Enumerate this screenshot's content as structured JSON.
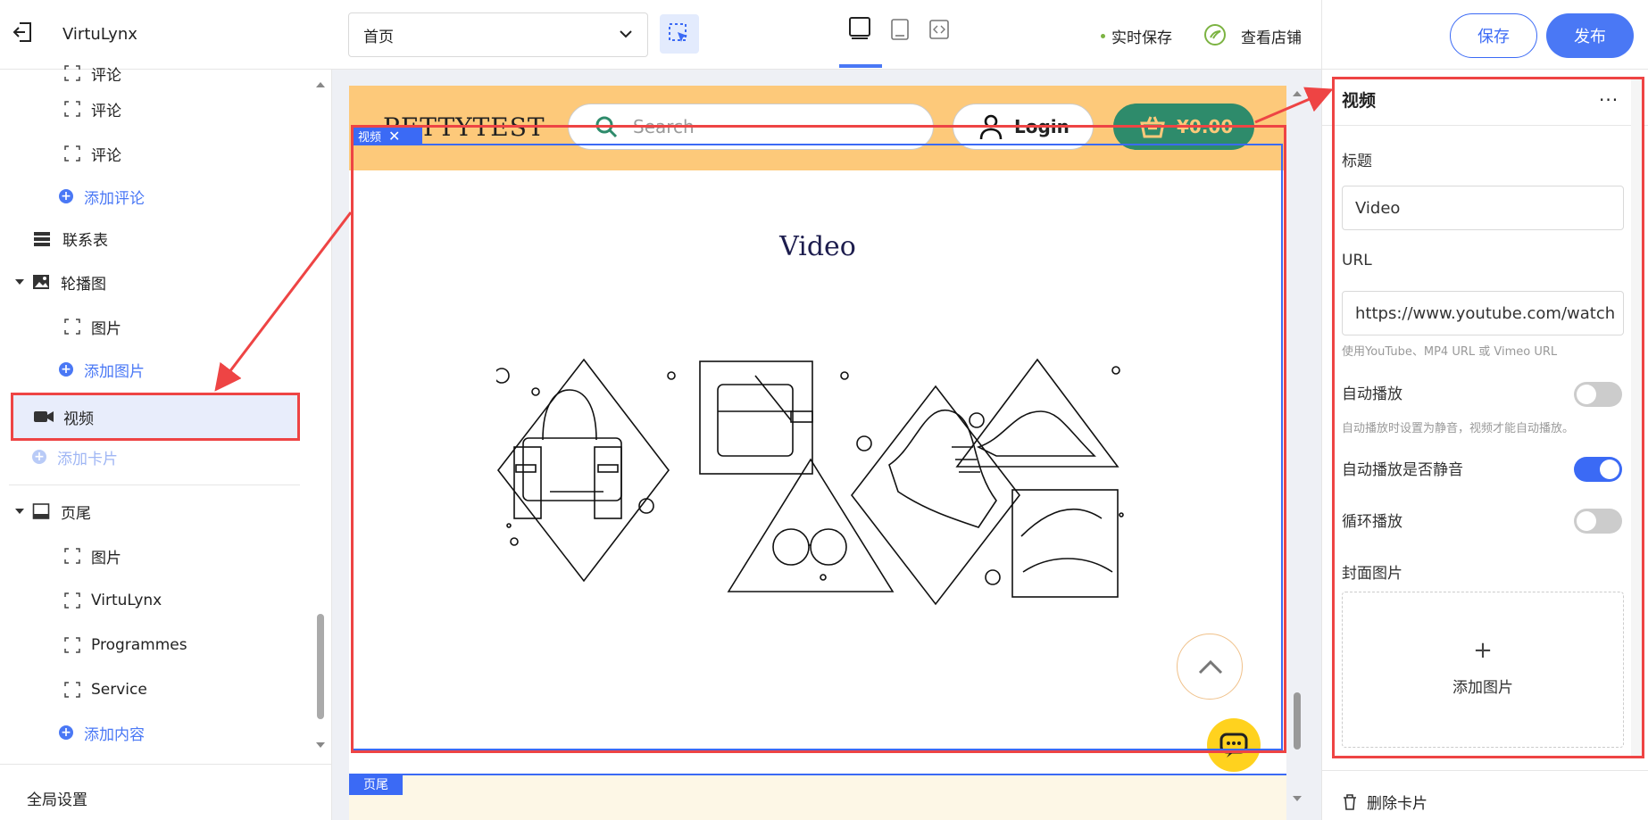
{
  "app": {
    "title": "VirtuLynx"
  },
  "toolbar": {
    "page_select": "首页",
    "realtime_save": "实时保存",
    "view_store": "查看店铺",
    "save": "保存",
    "publish": "发布"
  },
  "sidebar": {
    "items": [
      {
        "label": "评论",
        "type": "child"
      },
      {
        "label": "评论",
        "type": "child"
      },
      {
        "label": "评论",
        "type": "child"
      },
      {
        "label": "添加评论",
        "type": "add"
      },
      {
        "label": "联系表",
        "type": "section"
      },
      {
        "label": "轮播图",
        "type": "section"
      },
      {
        "label": "图片",
        "type": "child"
      },
      {
        "label": "添加图片",
        "type": "add"
      },
      {
        "label": "视频",
        "type": "selected"
      },
      {
        "label": "添加卡片",
        "type": "add-disabled"
      },
      {
        "label": "页尾",
        "type": "section"
      },
      {
        "label": "图片",
        "type": "child"
      },
      {
        "label": "VirtuLynx",
        "type": "child"
      },
      {
        "label": "Programmes",
        "type": "child"
      },
      {
        "label": "Service",
        "type": "child"
      },
      {
        "label": "添加内容",
        "type": "add"
      }
    ],
    "global_settings": "全局设置"
  },
  "canvas": {
    "logo": "PETTYTEST",
    "search_placeholder": "Search",
    "login": "Login",
    "cart": "¥0.00",
    "section_tag": "视频",
    "video_title": "Video",
    "footer_tag": "页尾"
  },
  "panel": {
    "title": "视频",
    "field_title_label": "标题",
    "field_title_value": "Video",
    "field_url_label": "URL",
    "field_url_value": "https://www.youtube.com/watch",
    "url_hint": "使用YouTube、MP4 URL 或 Vimeo URL",
    "autoplay_label": "自动播放",
    "autoplay_on": false,
    "autoplay_hint": "自动播放时设置为静音，视频才能自动播放。",
    "mute_label": "自动播放是否静音",
    "mute_on": true,
    "loop_label": "循环播放",
    "loop_on": false,
    "cover_label": "封面图片",
    "add_image": "添加图片",
    "delete_card": "删除卡片"
  },
  "colors": {
    "accent": "#4a78f5",
    "header_bg": "#fdc97a",
    "cart_bg": "#2e8b6b",
    "annotation": "#ee4444"
  }
}
